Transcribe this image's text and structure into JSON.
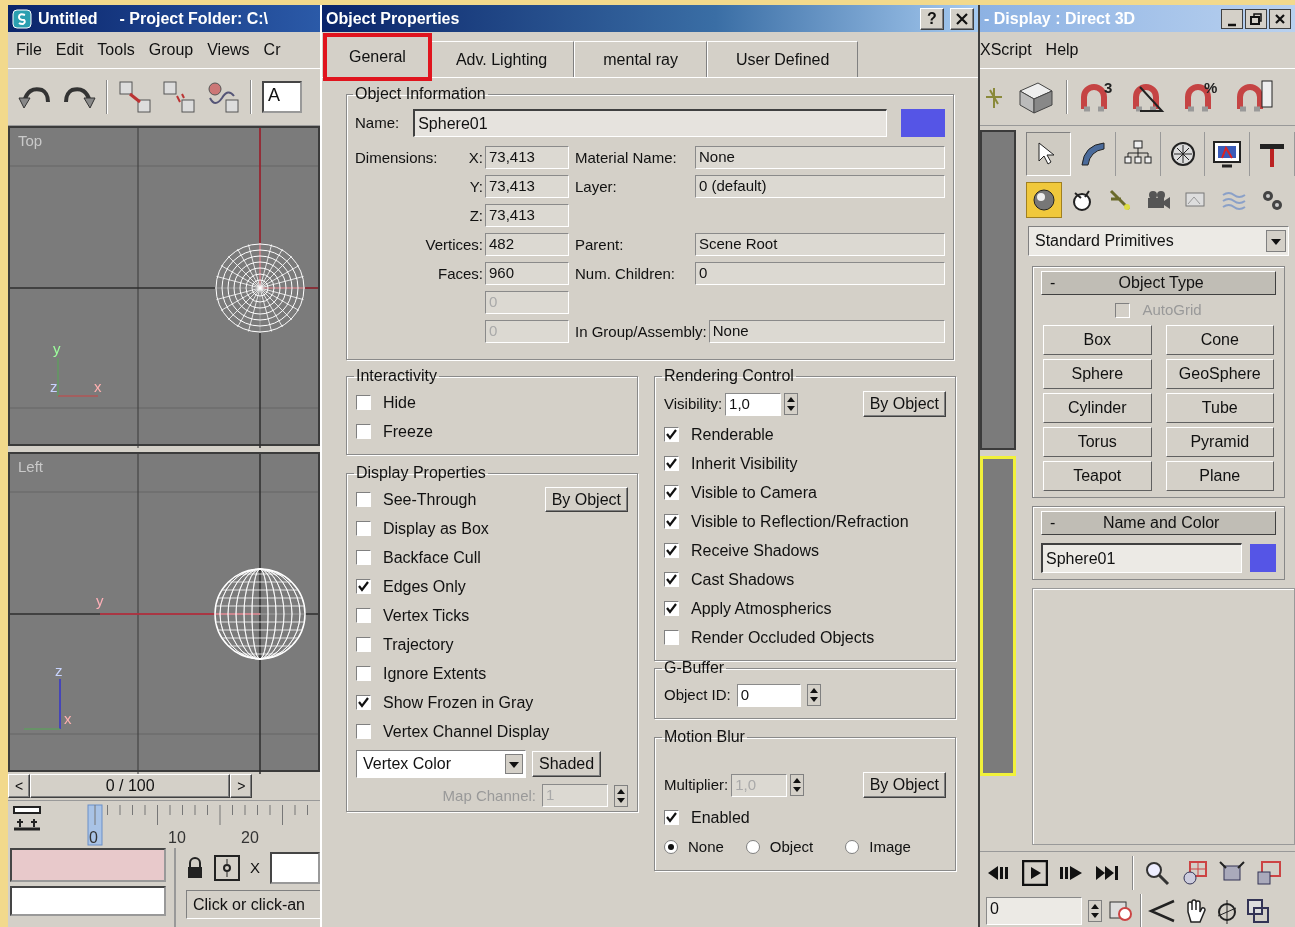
{
  "main_window": {
    "title": "Untitled",
    "title_path": "- Project Folder: C:\\",
    "menu": [
      "File",
      "Edit",
      "Tools",
      "Group",
      "Views",
      "Cr"
    ],
    "toolbar_field": "A"
  },
  "viewports": [
    {
      "label": "Top",
      "tripod": [
        "y",
        "z",
        "x"
      ],
      "active": false
    },
    {
      "label": "Left",
      "tripod": [
        "z",
        "x"
      ],
      "axis_label": "y",
      "active": true
    }
  ],
  "time_slider": {
    "prev": "<",
    "position": "0 / 100",
    "next": ">"
  },
  "track_bar": {
    "ticks": [
      "0",
      "10",
      "20"
    ]
  },
  "status": {
    "coord_label": "X",
    "prompt": "Click or click-an"
  },
  "dialog": {
    "title": "Object Properties",
    "help": "?",
    "tabs": [
      {
        "label": "General",
        "selected": true,
        "highlighted": true
      },
      {
        "label": "Adv. Lighting",
        "selected": false,
        "highlighted": false
      },
      {
        "label": "mental ray",
        "selected": false,
        "highlighted": false
      },
      {
        "label": "User Defined",
        "selected": false,
        "highlighted": false
      }
    ],
    "object_information": {
      "title": "Object Information",
      "name_label": "Name:",
      "name": "Sphere01",
      "color": "#5555e6",
      "rows": [
        {
          "label": "Dimensions:",
          "axis": "X:",
          "value": "73,413",
          "disabled": false,
          "label2": "Material Name:",
          "value2": "None"
        },
        {
          "axis": "Y:",
          "value": "73,413",
          "disabled": false,
          "label2": "Layer:",
          "value2": "0 (default)"
        },
        {
          "axis": "Z:",
          "value": "73,413",
          "disabled": false
        },
        {
          "label": "Vertices:",
          "value": "482",
          "disabled": false,
          "label2": "Parent:",
          "value2": "Scene Root"
        },
        {
          "label": "Faces:",
          "value": "960",
          "disabled": false,
          "label2": "Num. Children:",
          "value2": "0"
        },
        {
          "value": "0",
          "disabled": true
        },
        {
          "value": "0",
          "disabled": true,
          "label2": "In Group/Assembly:",
          "value2": "None"
        }
      ]
    },
    "interactivity": {
      "title": "Interactivity",
      "options": [
        {
          "label": "Hide",
          "checked": false
        },
        {
          "label": "Freeze",
          "checked": false
        }
      ]
    },
    "display_properties": {
      "title": "Display Properties",
      "by_object": "By Object",
      "options": [
        {
          "label": "See-Through",
          "checked": false
        },
        {
          "label": "Display as Box",
          "checked": false
        },
        {
          "label": "Backface Cull",
          "checked": false
        },
        {
          "label": "Edges Only",
          "checked": true
        },
        {
          "label": "Vertex Ticks",
          "checked": false
        },
        {
          "label": "Trajectory",
          "checked": false
        },
        {
          "label": "Ignore Extents",
          "checked": false
        },
        {
          "label": "Show Frozen in Gray",
          "checked": true
        },
        {
          "label": "Vertex Channel Display",
          "checked": false
        }
      ],
      "display_mode": "Vertex Color",
      "shading": "Shaded",
      "map_channel_label": "Map Channel:",
      "map_channel": "1",
      "map_channel_disabled": true
    },
    "rendering_control": {
      "title": "Rendering Control",
      "visibility_label": "Visibility:",
      "visibility": "1,0",
      "by_object": "By Object",
      "options": [
        {
          "label": "Renderable",
          "checked": true
        },
        {
          "label": "Inherit Visibility",
          "checked": true
        },
        {
          "label": "Visible to Camera",
          "checked": true
        },
        {
          "label": "Visible to Reflection/Refraction",
          "checked": true
        },
        {
          "label": "Receive Shadows",
          "checked": true
        },
        {
          "label": "Cast Shadows",
          "checked": true
        },
        {
          "label": "Apply Atmospherics",
          "checked": true
        },
        {
          "label": "Render Occluded Objects",
          "checked": false
        }
      ]
    },
    "g_buffer": {
      "title": "G-Buffer",
      "object_id_label": "Object ID:",
      "object_id": "0"
    },
    "motion_blur": {
      "title": "Motion Blur",
      "multiplier_label": "Multiplier:",
      "multiplier": "1,0",
      "multiplier_disabled": true,
      "by_object": "By Object",
      "enabled": {
        "label": "Enabled",
        "checked": true
      },
      "types": [
        {
          "label": "None",
          "selected": true
        },
        {
          "label": "Object",
          "selected": false
        },
        {
          "label": "Image",
          "selected": false
        }
      ]
    }
  },
  "side_window": {
    "title": "- Display : Direct 3D",
    "menu": [
      "XScript",
      "Help"
    ],
    "snap_marks": [
      "3",
      "%"
    ]
  },
  "command_panel": {
    "tabs": [
      {
        "selected": true
      },
      {
        "selected": false
      },
      {
        "selected": false
      },
      {
        "selected": false
      },
      {
        "selected": false
      },
      {
        "selected": false
      }
    ],
    "categories": [
      {
        "selected": true
      },
      {
        "selected": false
      },
      {
        "selected": false
      },
      {
        "selected": false
      },
      {
        "selected": false
      },
      {
        "selected": false
      },
      {
        "selected": false
      }
    ],
    "dropdown": "Standard Primitives",
    "object_type": {
      "collapse": "-",
      "title": "Object Type",
      "autogrid": {
        "label": "AutoGrid",
        "checked": false,
        "disabled": true
      },
      "buttons": [
        "Box",
        "Cone",
        "Sphere",
        "GeoSphere",
        "Cylinder",
        "Tube",
        "Torus",
        "Pyramid",
        "Teapot",
        "Plane"
      ]
    },
    "name_and_color": {
      "collapse": "-",
      "title": "Name and Color",
      "name": "Sphere01",
      "color": "#5555e6"
    }
  },
  "animation": {
    "frame": "0"
  }
}
